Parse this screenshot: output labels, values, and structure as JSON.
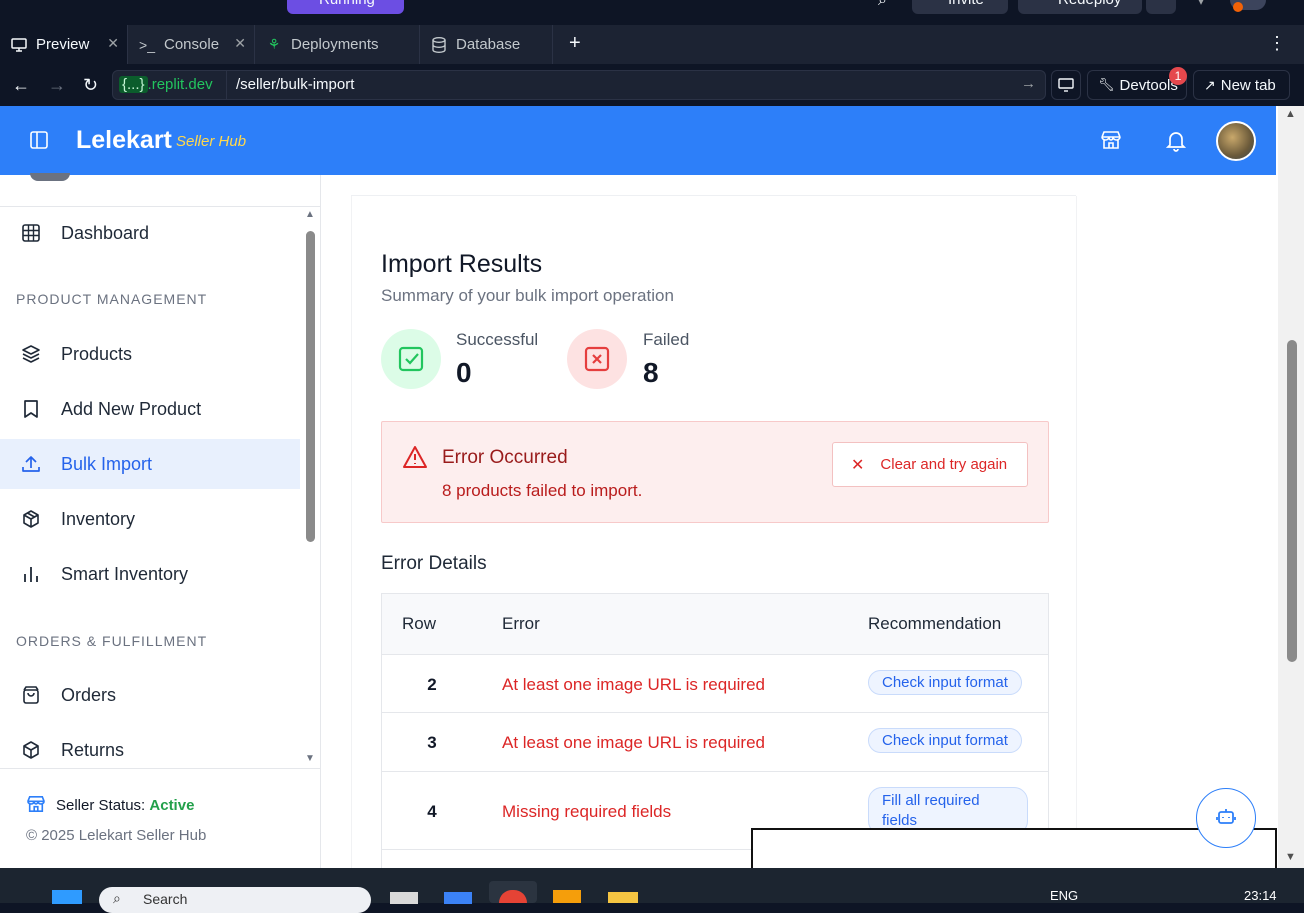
{
  "topbar": {
    "running_label": "Running",
    "invite_label": "Invite",
    "redeploy_label": "Redeploy"
  },
  "tabs": [
    {
      "label": "Preview",
      "icon": "monitor-icon"
    },
    {
      "label": "Console",
      "icon": "terminal-icon"
    },
    {
      "label": "Deployments",
      "icon": "tree-icon"
    },
    {
      "label": "Database",
      "icon": "database-icon"
    }
  ],
  "urlbar": {
    "domain_brace": "{...}",
    "domain": ".replit.dev",
    "path": "/seller/bulk-import",
    "devtools_label": "Devtools",
    "devtools_badge": "1",
    "newtab_label": "New tab"
  },
  "header": {
    "brand": "Lelekart",
    "brand_sub": "Seller Hub"
  },
  "sidebar": {
    "dashboard": "Dashboard",
    "section_product": "PRODUCT MANAGEMENT",
    "products": "Products",
    "add_new": "Add New Product",
    "bulk_import": "Bulk Import",
    "inventory": "Inventory",
    "smart_inventory": "Smart Inventory",
    "section_orders": "ORDERS & FULFILLMENT",
    "orders": "Orders",
    "returns": "Returns",
    "status_label": "Seller Status:",
    "status_value": "Active",
    "copyright": "© 2025 Lelekart Seller Hub"
  },
  "results": {
    "title": "Import Results",
    "subtitle": "Summary of your bulk import operation",
    "successful_label": "Successful",
    "successful_value": "0",
    "failed_label": "Failed",
    "failed_value": "8"
  },
  "error_alert": {
    "title": "Error Occurred",
    "message": "8 products failed to import.",
    "clear_label": "Clear and try again"
  },
  "error_details": {
    "title": "Error Details",
    "headers": {
      "row": "Row",
      "error": "Error",
      "recommendation": "Recommendation"
    },
    "rows": [
      {
        "row": "2",
        "error": "At least one image URL is required",
        "recommendation": "Check input format"
      },
      {
        "row": "3",
        "error": "At least one image URL is required",
        "recommendation": "Check input format"
      },
      {
        "row": "4",
        "error": "Missing required fields",
        "recommendation": "Fill all required fields"
      }
    ]
  },
  "taskbar": {
    "search_placeholder": "Search",
    "lang": "ENG",
    "time": "23:14"
  },
  "colors": {
    "brand_blue": "#2d7ff9",
    "success_green": "#22c55e",
    "error_red": "#dc2626",
    "active_nav_bg": "#e8f0fd"
  }
}
